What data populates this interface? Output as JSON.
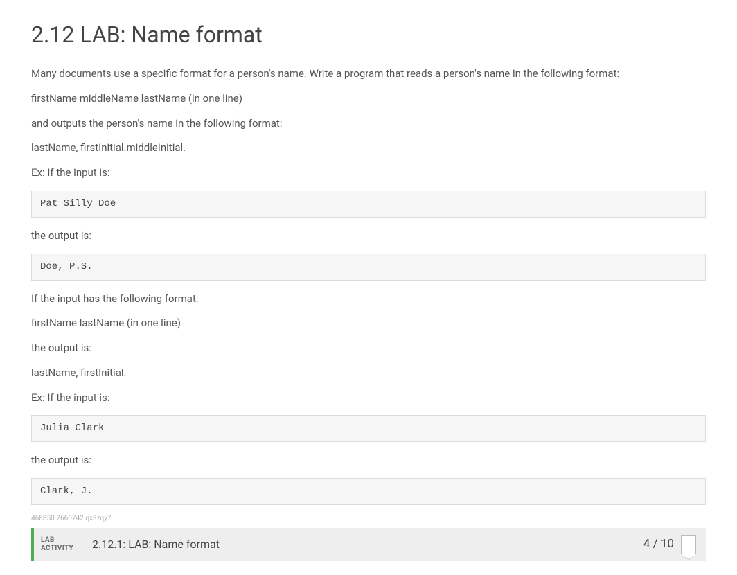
{
  "title": "2.12 LAB: Name format",
  "paragraphs": {
    "intro": "Many documents use a specific format for a person's name. Write a program that reads a person's name in the following format:",
    "format1": "firstName middleName lastName (in one line)",
    "outputDesc1": "and outputs the person's name in the following format:",
    "outputFormat1": "lastName, firstInitial.middleInitial.",
    "exIntro1": "Ex: If the input is:",
    "outputIs1": "the output is:",
    "alt": "If the input has the following format:",
    "format2": "firstName lastName (in one line)",
    "outputIs2": "the output is:",
    "outputFormat2": "lastName, firstInitial.",
    "exIntro2": "Ex: If the input is:",
    "outputIs3": "the output is:"
  },
  "code": {
    "input1": "Pat Silly Doe",
    "output1": "Doe, P.S.",
    "input2": "Julia Clark",
    "output2": "Clark, J."
  },
  "smallId": "468850.2660742.qx3zqy7",
  "activity": {
    "label1": "LAB",
    "label2": "ACTIVITY",
    "title": "2.12.1: LAB: Name format",
    "score": "4 / 10"
  }
}
